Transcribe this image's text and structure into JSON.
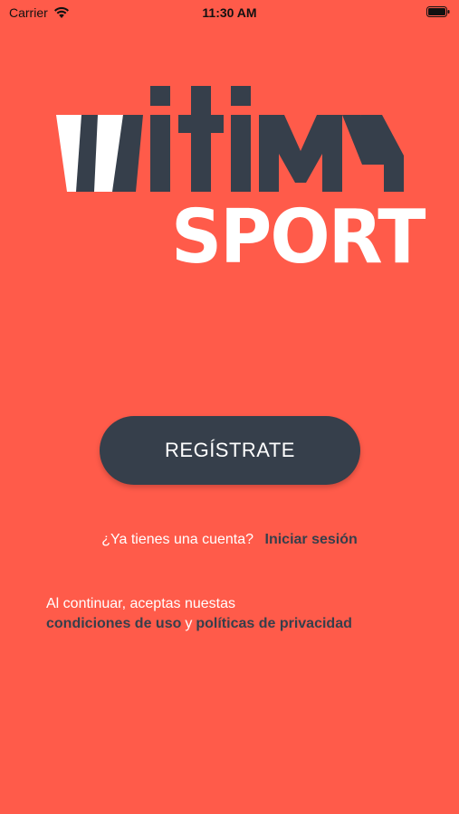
{
  "status_bar": {
    "carrier": "Carrier",
    "time": "11:30 AM"
  },
  "logo": {
    "text_main": "witim",
    "text_sub": "SPORT",
    "colors": {
      "dark": "#363F4B",
      "white": "#FFFFFF"
    }
  },
  "actions": {
    "register_label": "REGÍSTRATE",
    "have_account_text": "¿Ya tienes una cuenta?",
    "login_label": "Iniciar sesión"
  },
  "terms": {
    "intro": "Al continuar, aceptas nuestas",
    "terms_link": "condiciones de uso",
    "conjunction": "y",
    "privacy_link": "políticas de privacidad"
  },
  "colors": {
    "background": "#FF5B4A",
    "button": "#363F4B",
    "text_light": "#FFFFFF",
    "text_dark": "#363F4B"
  }
}
